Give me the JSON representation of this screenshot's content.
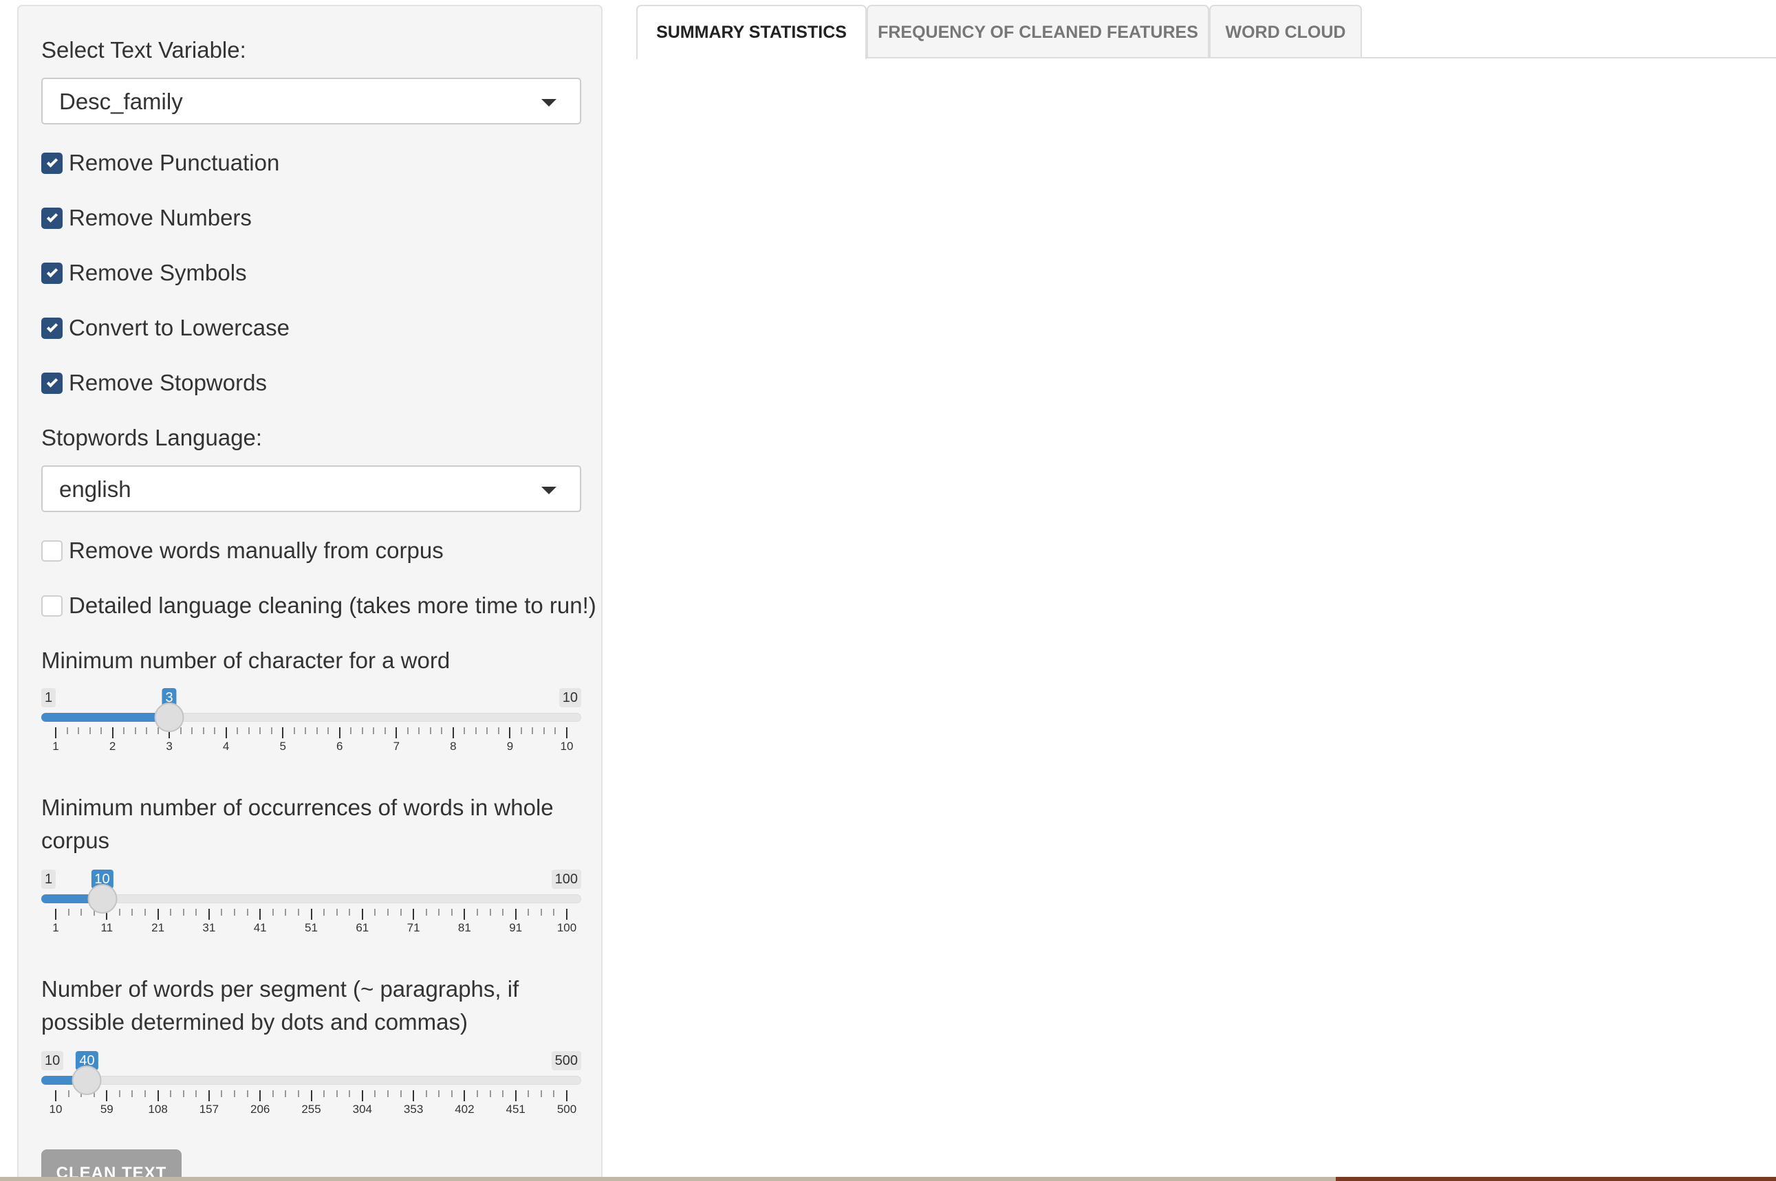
{
  "sidebar": {
    "text_variable": {
      "label": "Select Text Variable:",
      "value": "Desc_family"
    },
    "checkboxes": [
      {
        "label": "Remove Punctuation",
        "checked": true
      },
      {
        "label": "Remove Numbers",
        "checked": true
      },
      {
        "label": "Remove Symbols",
        "checked": true
      },
      {
        "label": "Convert to Lowercase",
        "checked": true
      },
      {
        "label": "Remove Stopwords",
        "checked": true
      }
    ],
    "stopwords_language": {
      "label": "Stopwords Language:",
      "value": "english"
    },
    "manual_remove": {
      "label": "Remove words manually from corpus",
      "checked": false
    },
    "detailed_cleaning": {
      "label": "Detailed language cleaning (takes more time to run!)",
      "checked": false
    },
    "sliders": [
      {
        "label": "Minimum number of character for a word",
        "min": "1",
        "max": "10",
        "value": "3",
        "fraction": 0.2222,
        "ticks": [
          "1",
          "2",
          "3",
          "4",
          "5",
          "6",
          "7",
          "8",
          "9",
          "10"
        ]
      },
      {
        "label": "Minimum number of occurrences of words in whole corpus",
        "min": "1",
        "max": "100",
        "value": "10",
        "fraction": 0.0909,
        "ticks": [
          "1",
          "11",
          "21",
          "31",
          "41",
          "51",
          "61",
          "71",
          "81",
          "91",
          "100"
        ]
      },
      {
        "label": "Number of words per segment (~ paragraphs, if possible determined by dots and commas)",
        "min": "10",
        "max": "500",
        "value": "40",
        "fraction": 0.0612,
        "ticks": [
          "10",
          "59",
          "108",
          "157",
          "206",
          "255",
          "304",
          "353",
          "402",
          "451",
          "500"
        ]
      }
    ],
    "clean_button": "CLEAN TEXT"
  },
  "tabs": [
    {
      "label": "SUMMARY STATISTICS",
      "active": true
    },
    {
      "label": "FREQUENCY OF CLEANED FEATURES",
      "active": false
    },
    {
      "label": "WORD CLOUD",
      "active": false
    }
  ],
  "colors": {
    "accent": "#428bca",
    "checkbox": "#2c4f7c",
    "sidebar_bg": "#f5f5f5",
    "button_bg": "#a0a0a0"
  }
}
